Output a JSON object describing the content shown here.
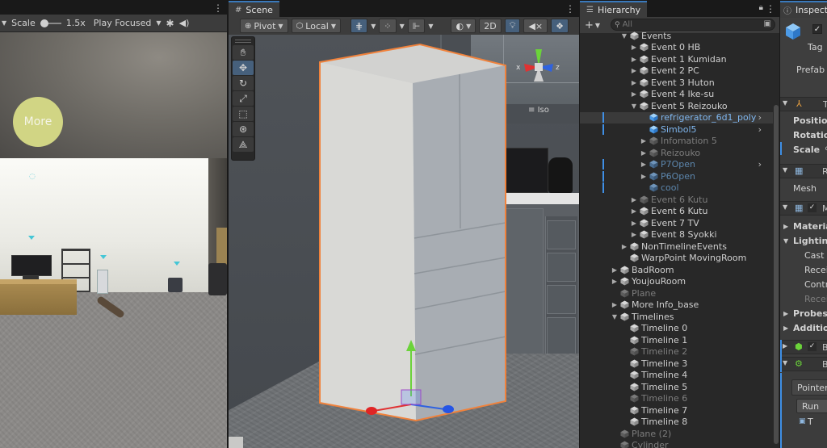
{
  "game": {
    "scale_label": "Scale",
    "scale_value": "1.5x",
    "play_mode": "Play Focused",
    "more_button": "More"
  },
  "scene": {
    "tab_title": "Scene",
    "pivot": "Pivot",
    "local": "Local",
    "mode_2d": "2D",
    "gizmo_label": "Iso",
    "axis_x": "x",
    "axis_z": "z"
  },
  "hierarchy": {
    "tab_title": "Hierarchy",
    "search_placeholder": "All",
    "rows": [
      {
        "label": "Events",
        "indent": 4,
        "arrow": "▼",
        "state": "normal"
      },
      {
        "label": "Event 0 HB",
        "indent": 5,
        "arrow": "▶",
        "state": "normal"
      },
      {
        "label": "Event 1 Kumidan",
        "indent": 5,
        "arrow": "▶",
        "state": "normal"
      },
      {
        "label": "Event 2 PC",
        "indent": 5,
        "arrow": "▶",
        "state": "normal"
      },
      {
        "label": "Event 3 Huton",
        "indent": 5,
        "arrow": "▶",
        "state": "normal"
      },
      {
        "label": "Event 4 Ike-su",
        "indent": 5,
        "arrow": "▶",
        "state": "normal"
      },
      {
        "label": "Event 5 Reizouko",
        "indent": 5,
        "arrow": "▼",
        "state": "normal"
      },
      {
        "label": "refrigerator_6d1_poly",
        "indent": 6,
        "arrow": "",
        "state": "sel-prefab",
        "chev": true,
        "mark": true
      },
      {
        "label": "Simbol5",
        "indent": 6,
        "arrow": "",
        "state": "prefab",
        "chev": true,
        "mark": true
      },
      {
        "label": "Infomation 5",
        "indent": 6,
        "arrow": "▶",
        "state": "dim"
      },
      {
        "label": "Reizouko",
        "indent": 6,
        "arrow": "▶",
        "state": "dim"
      },
      {
        "label": "P7Open",
        "indent": 6,
        "arrow": "▶",
        "state": "dimprefab",
        "chev": true,
        "mark": true
      },
      {
        "label": "P6Open",
        "indent": 6,
        "arrow": "▶",
        "state": "dimprefab",
        "mark": true
      },
      {
        "label": "cool",
        "indent": 6,
        "arrow": "",
        "state": "dimprefab",
        "mark": true
      },
      {
        "label": "Event 6 Kutu",
        "indent": 5,
        "arrow": "▶",
        "state": "dim"
      },
      {
        "label": "Event 6 Kutu",
        "indent": 5,
        "arrow": "▶",
        "state": "normal"
      },
      {
        "label": "Event 7 TV",
        "indent": 5,
        "arrow": "▶",
        "state": "normal"
      },
      {
        "label": "Event 8 Syokki",
        "indent": 5,
        "arrow": "▶",
        "state": "normal"
      },
      {
        "label": "NonTimelineEvents",
        "indent": 4,
        "arrow": "▶",
        "state": "normal"
      },
      {
        "label": "WarpPoint MovingRoom",
        "indent": 4,
        "arrow": "",
        "state": "normal"
      },
      {
        "label": "BadRoom",
        "indent": 3,
        "arrow": "▶",
        "state": "normal"
      },
      {
        "label": "YoujouRoom",
        "indent": 3,
        "arrow": "▶",
        "state": "normal"
      },
      {
        "label": "Plane",
        "indent": 3,
        "arrow": "",
        "state": "dim"
      },
      {
        "label": "More Info_base",
        "indent": 3,
        "arrow": "▶",
        "state": "normal"
      },
      {
        "label": "Timelines",
        "indent": 3,
        "arrow": "▼",
        "state": "normal"
      },
      {
        "label": "Timeline 0",
        "indent": 4,
        "arrow": "",
        "state": "normal"
      },
      {
        "label": "Timeline 1",
        "indent": 4,
        "arrow": "",
        "state": "normal"
      },
      {
        "label": "Timeline 2",
        "indent": 4,
        "arrow": "",
        "state": "dim"
      },
      {
        "label": "Timeline 3",
        "indent": 4,
        "arrow": "",
        "state": "normal"
      },
      {
        "label": "Timeline 4",
        "indent": 4,
        "arrow": "",
        "state": "normal"
      },
      {
        "label": "Timeline 5",
        "indent": 4,
        "arrow": "",
        "state": "normal"
      },
      {
        "label": "Timeline 6",
        "indent": 4,
        "arrow": "",
        "state": "dim"
      },
      {
        "label": "Timeline 7",
        "indent": 4,
        "arrow": "",
        "state": "normal"
      },
      {
        "label": "Timeline 8",
        "indent": 4,
        "arrow": "",
        "state": "normal"
      },
      {
        "label": "Plane (2)",
        "indent": 3,
        "arrow": "",
        "state": "dim"
      },
      {
        "label": "Cylinder",
        "indent": 3,
        "arrow": "",
        "state": "dim"
      }
    ]
  },
  "inspector": {
    "tab_title": "Inspect",
    "tag": "Tag",
    "prefab": "Prefab",
    "position": "Position",
    "rotation": "Rotation",
    "scale": "Scale",
    "mesh": "Mesh",
    "materials": "Materia",
    "lighting": "Lighting",
    "cast": "Cast",
    "receive": "Recei",
    "contribute": "Contri",
    "receive2": "Recei",
    "probes": "Probes",
    "additional": "Additio",
    "pointer": "Pointer",
    "runtime": "Run",
    "transform_short": "T",
    "comp_t": "T",
    "comp_r": "R",
    "comp_m": "M",
    "comp_b1": "B",
    "comp_b2": "B"
  },
  "colors": {
    "accent": "#3a79bb",
    "prefab_text": "#7fb6ee",
    "selection_orange": "#f0823c"
  }
}
